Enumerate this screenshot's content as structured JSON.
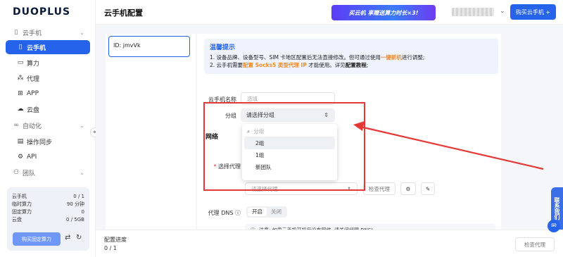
{
  "sidebar": {
    "logo": "DUOPLUS",
    "groups": [
      {
        "label": "云手机",
        "icon": "phone-icon"
      },
      {
        "label": "自动化",
        "icon": "infinity-icon"
      },
      {
        "label": "团队",
        "icon": "team-icon"
      }
    ],
    "items": {
      "cloud_phone": "云手机",
      "compute": "算力",
      "proxy": "代理",
      "app": "APP",
      "disk": "云盘",
      "sync": "操作同步",
      "api": "API"
    },
    "stats": [
      {
        "label": "云手机",
        "value": "0 / 1"
      },
      {
        "label": "临时算力",
        "value": "90 分钟"
      },
      {
        "label": "固定算力",
        "value": "0"
      },
      {
        "label": "云盘",
        "value": "0 / 5GB"
      }
    ],
    "buy_button": "购买固定算力",
    "collapse_glyph": "«"
  },
  "header": {
    "title": "云手机配置",
    "banner": "买云机 享赠送算力时长×3!",
    "buy_button": "购买云手机 +"
  },
  "phone_list": {
    "id_label": "ID: jmvVk"
  },
  "tip": {
    "title": "温馨提示",
    "line1_a": "1. 设备品牌、设备型号、SIM 卡地区配置后无法直接修改。但可通过使用",
    "line1_highlight": "一键新机",
    "line1_b": "进行调整;",
    "line2_a": "2. 云手机需要",
    "line2_highlight": "配置 Socks5 类型代理 IP",
    "line2_b": " 才能使用。详见",
    "line2_link": "配置教程",
    "line2_c": ";"
  },
  "form": {
    "name_label": "云手机名称",
    "name_placeholder": "选填",
    "group_label": "分组",
    "group_value": "请选择分组",
    "network_section": "网络",
    "proxy_label": "选择代理",
    "proxy_placeholder": "请选择代理",
    "check_proxy": "检查代理",
    "dns_label": "代理 DNS",
    "dns_on": "开启",
    "dns_off": "关闭",
    "dns_note": "注意: 如果云手机开机后没有网络, 请关闭代理 DNS!"
  },
  "dropdown": {
    "search_placeholder": "分组",
    "options": [
      "2组",
      "1组",
      "新团队"
    ]
  },
  "footer": {
    "progress_label": "配置进度",
    "progress_value": "0 / 1",
    "check_button": "检查代理"
  },
  "side_tab": "联系我们",
  "colors": {
    "accent": "#2563eb",
    "highlight_orange": "#f08a24",
    "annotation_red": "#e53935"
  }
}
